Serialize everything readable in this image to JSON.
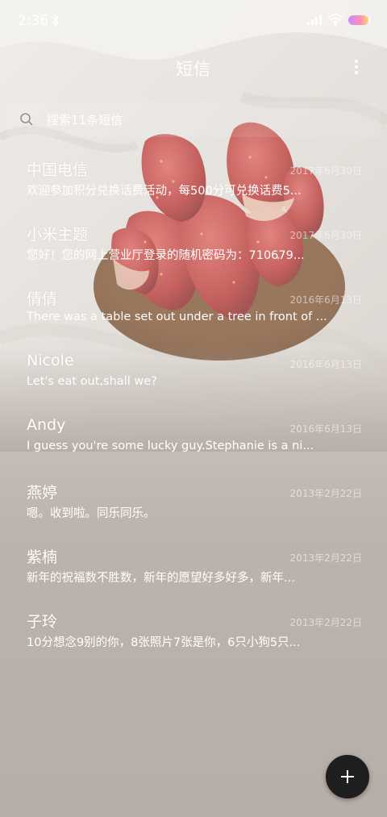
{
  "status": {
    "time": "2:36"
  },
  "header": {
    "title": "短信"
  },
  "search": {
    "placeholder": "搜索11条短信"
  },
  "messages": [
    {
      "sender": "中国电信",
      "date": "2017年6月30日",
      "preview": "欢迎参加积分兑换话费活动，每500分可兑换话费5..."
    },
    {
      "sender": "小米主题",
      "date": "2017年6月30日",
      "preview": "您好！您的网上营业厅登录的随机密码为：710679..."
    },
    {
      "sender": "倩倩",
      "date": "2016年6月13日",
      "preview": "There was a table set out under a tree in front of ..."
    },
    {
      "sender": "Nicole",
      "date": "2016年6月13日",
      "preview": "Let's eat out,shall we?"
    },
    {
      "sender": "Andy",
      "date": "2016年6月13日",
      "preview": "I guess you're some lucky guy.Stephanie is a ni..."
    },
    {
      "sender": "燕婷",
      "date": "2013年2月22日",
      "preview": "嗯。收到啦。同乐同乐。"
    },
    {
      "sender": "紫楠",
      "date": "2013年2月22日",
      "preview": "新年的祝福数不胜数，新年的愿望好多好多，新年..."
    },
    {
      "sender": "子玲",
      "date": "2013年2月22日",
      "preview": "10分想念9别的你，8张照片7张是你，6只小狗5只..."
    }
  ],
  "icons": {
    "bluetooth": "bluetooth-icon",
    "signal": "signal-icon",
    "wifi": "wifi-icon",
    "battery": "battery-icon",
    "more": "more-vertical-icon",
    "search": "search-icon",
    "compose": "plus-icon"
  },
  "colors": {
    "text": "#ffffff",
    "fab": "#1e1e1e",
    "strawberry": "#c8383a",
    "bowl": "#8a5a36"
  }
}
